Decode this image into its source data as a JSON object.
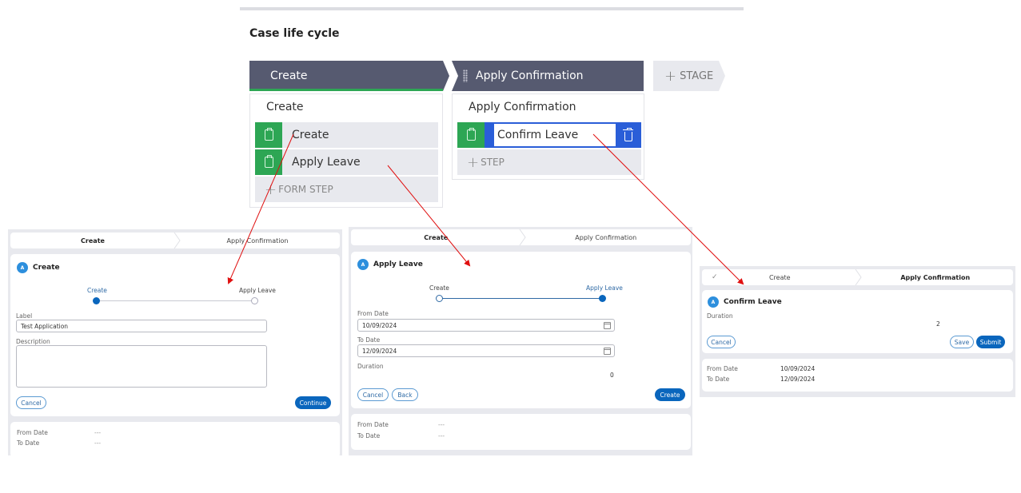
{
  "lifecycle": {
    "title": "Case life cycle",
    "stages": [
      {
        "label": "Create"
      },
      {
        "label": "Apply Confirmation"
      }
    ],
    "add_stage_label": "STAGE",
    "columns": {
      "create": {
        "heading": "Create",
        "steps": [
          {
            "label": "Create",
            "icon": "clipboard-icon"
          },
          {
            "label": "Apply Leave",
            "icon": "clipboard-icon"
          }
        ],
        "add_step_label": "FORM STEP"
      },
      "apply": {
        "heading": "Apply Confirmation",
        "steps": [
          {
            "label": "Confirm Leave",
            "icon": "clipboard-icon",
            "selected": true
          }
        ],
        "add_step_label": "STEP"
      }
    }
  },
  "panels": {
    "create": {
      "breadcrumb": [
        "Create",
        "Apply Confirmation"
      ],
      "avatar": "A",
      "title": "Create",
      "progress": {
        "steps": [
          "Create",
          "Apply Leave"
        ],
        "current_index": 0
      },
      "label_field": {
        "label": "Label",
        "value": "Test Application"
      },
      "description_field": {
        "label": "Description",
        "value": ""
      },
      "cancel_label": "Cancel",
      "continue_label": "Continue",
      "summary": [
        {
          "label": "From Date",
          "value": "---"
        },
        {
          "label": "To Date",
          "value": "---"
        }
      ]
    },
    "apply_leave": {
      "breadcrumb": [
        "Create",
        "Apply Confirmation"
      ],
      "avatar": "A",
      "title": "Apply Leave",
      "progress": {
        "steps": [
          "Create",
          "Apply Leave"
        ],
        "current_index": 1
      },
      "from_date": {
        "label": "From Date",
        "value": "10/09/2024"
      },
      "to_date": {
        "label": "To Date",
        "value": "12/09/2024"
      },
      "duration": {
        "label": "Duration",
        "value": "0"
      },
      "cancel_label": "Cancel",
      "back_label": "Back",
      "create_label": "Create",
      "summary": [
        {
          "label": "From Date",
          "value": "---"
        },
        {
          "label": "To Date",
          "value": "---"
        }
      ]
    },
    "confirm": {
      "breadcrumb": [
        "Create",
        "Apply Confirmation"
      ],
      "check_icon": "checkmark-icon",
      "avatar": "A",
      "title": "Confirm Leave",
      "duration": {
        "label": "Duration",
        "value": "2"
      },
      "cancel_label": "Cancel",
      "save_label": "Save",
      "submit_label": "Submit",
      "summary": [
        {
          "label": "From Date",
          "value": "10/09/2024"
        },
        {
          "label": "To Date",
          "value": "12/09/2024"
        }
      ]
    }
  },
  "colors": {
    "stage_bg": "#565a70",
    "step_green": "#2da654",
    "selected_blue": "#2a5ed8",
    "primary_button": "#0a66bd",
    "arrow_red": "#e01010",
    "panel_bg": "#e8e9ee"
  }
}
